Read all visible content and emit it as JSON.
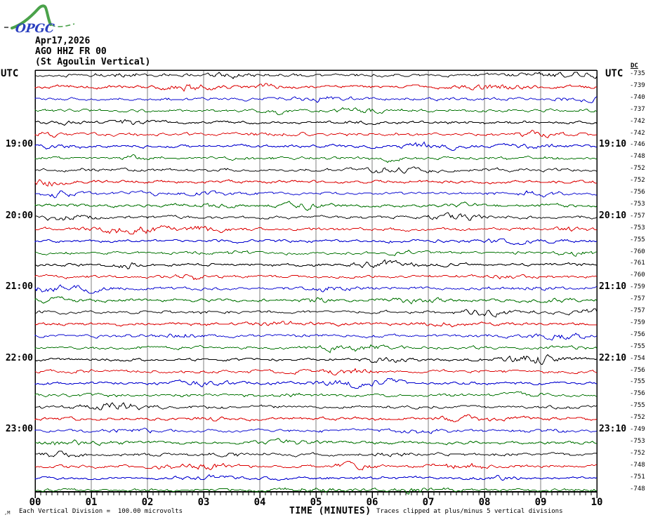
{
  "header": {
    "logo_text": "OPGC",
    "date": "Apr17,2026",
    "station_code": "AGO HHZ FR 00",
    "station_name": "(St Agoulin Vertical)"
  },
  "axes": {
    "left_utc_label": "UTC",
    "right_utc_label": "UTC",
    "dc_header": "DC",
    "x_axis_title": "TIME (MINUTES)",
    "x_tick_labels": [
      "00",
      "01",
      "02",
      "03",
      "04",
      "05",
      "06",
      "07",
      "08",
      "09",
      "10"
    ],
    "left_hour_labels": [
      {
        "row": 7,
        "text": "19:00"
      },
      {
        "row": 13,
        "text": "20:00"
      },
      {
        "row": 19,
        "text": "21:00"
      },
      {
        "row": 25,
        "text": "22:00"
      },
      {
        "row": 31,
        "text": "23:00"
      }
    ],
    "right_hour_labels": [
      {
        "row": 7,
        "text": "19:10"
      },
      {
        "row": 13,
        "text": "20:10"
      },
      {
        "row": 19,
        "text": "21:10"
      },
      {
        "row": 25,
        "text": "22:10"
      },
      {
        "row": 31,
        "text": "23:10"
      }
    ]
  },
  "footer": {
    "mark": ",M",
    "scale_note": "Each Vertical Division =  100.00 microvolts",
    "clip_note": "Traces clipped at plus/minus 5 vertical divisions"
  },
  "chart_data": {
    "type": "line",
    "title": "AGO HHZ FR 00 (St Agoulin Vertical) helicorder, Apr17,2026",
    "xlabel": "TIME (MINUTES)",
    "x_range_minutes": [
      0,
      10
    ],
    "x_major_tick_minutes": 1,
    "x_minor_tick_minutes": 0.1,
    "minutes_per_row": 10,
    "grid": true,
    "grid_color": "#7f7f7f",
    "trace_colors": {
      "black": "#000000",
      "red": "#dd0000",
      "blue": "#0000cf",
      "green": "#007200"
    },
    "rows": [
      {
        "color": "black",
        "dc": -735
      },
      {
        "color": "red",
        "dc": -739
      },
      {
        "color": "blue",
        "dc": -740
      },
      {
        "color": "green",
        "dc": -737
      },
      {
        "color": "black",
        "dc": -742
      },
      {
        "color": "red",
        "dc": -742
      },
      {
        "color": "blue",
        "dc": -746
      },
      {
        "color": "green",
        "dc": -748
      },
      {
        "color": "black",
        "dc": -752
      },
      {
        "color": "red",
        "dc": -752
      },
      {
        "color": "blue",
        "dc": -756
      },
      {
        "color": "green",
        "dc": -753
      },
      {
        "color": "black",
        "dc": -757
      },
      {
        "color": "red",
        "dc": -753
      },
      {
        "color": "blue",
        "dc": -755
      },
      {
        "color": "green",
        "dc": -760
      },
      {
        "color": "black",
        "dc": -761
      },
      {
        "color": "red",
        "dc": -760
      },
      {
        "color": "blue",
        "dc": -759
      },
      {
        "color": "green",
        "dc": -757
      },
      {
        "color": "black",
        "dc": -757
      },
      {
        "color": "red",
        "dc": -759
      },
      {
        "color": "blue",
        "dc": -756
      },
      {
        "color": "green",
        "dc": -755
      },
      {
        "color": "black",
        "dc": -754
      },
      {
        "color": "red",
        "dc": -756
      },
      {
        "color": "blue",
        "dc": -755
      },
      {
        "color": "green",
        "dc": -756
      },
      {
        "color": "black",
        "dc": -755
      },
      {
        "color": "red",
        "dc": -752
      },
      {
        "color": "blue",
        "dc": -749
      },
      {
        "color": "green",
        "dc": -753
      },
      {
        "color": "black",
        "dc": -752
      },
      {
        "color": "red",
        "dc": -748
      },
      {
        "color": "blue",
        "dc": -751
      },
      {
        "color": "green",
        "dc": -748
      }
    ]
  }
}
